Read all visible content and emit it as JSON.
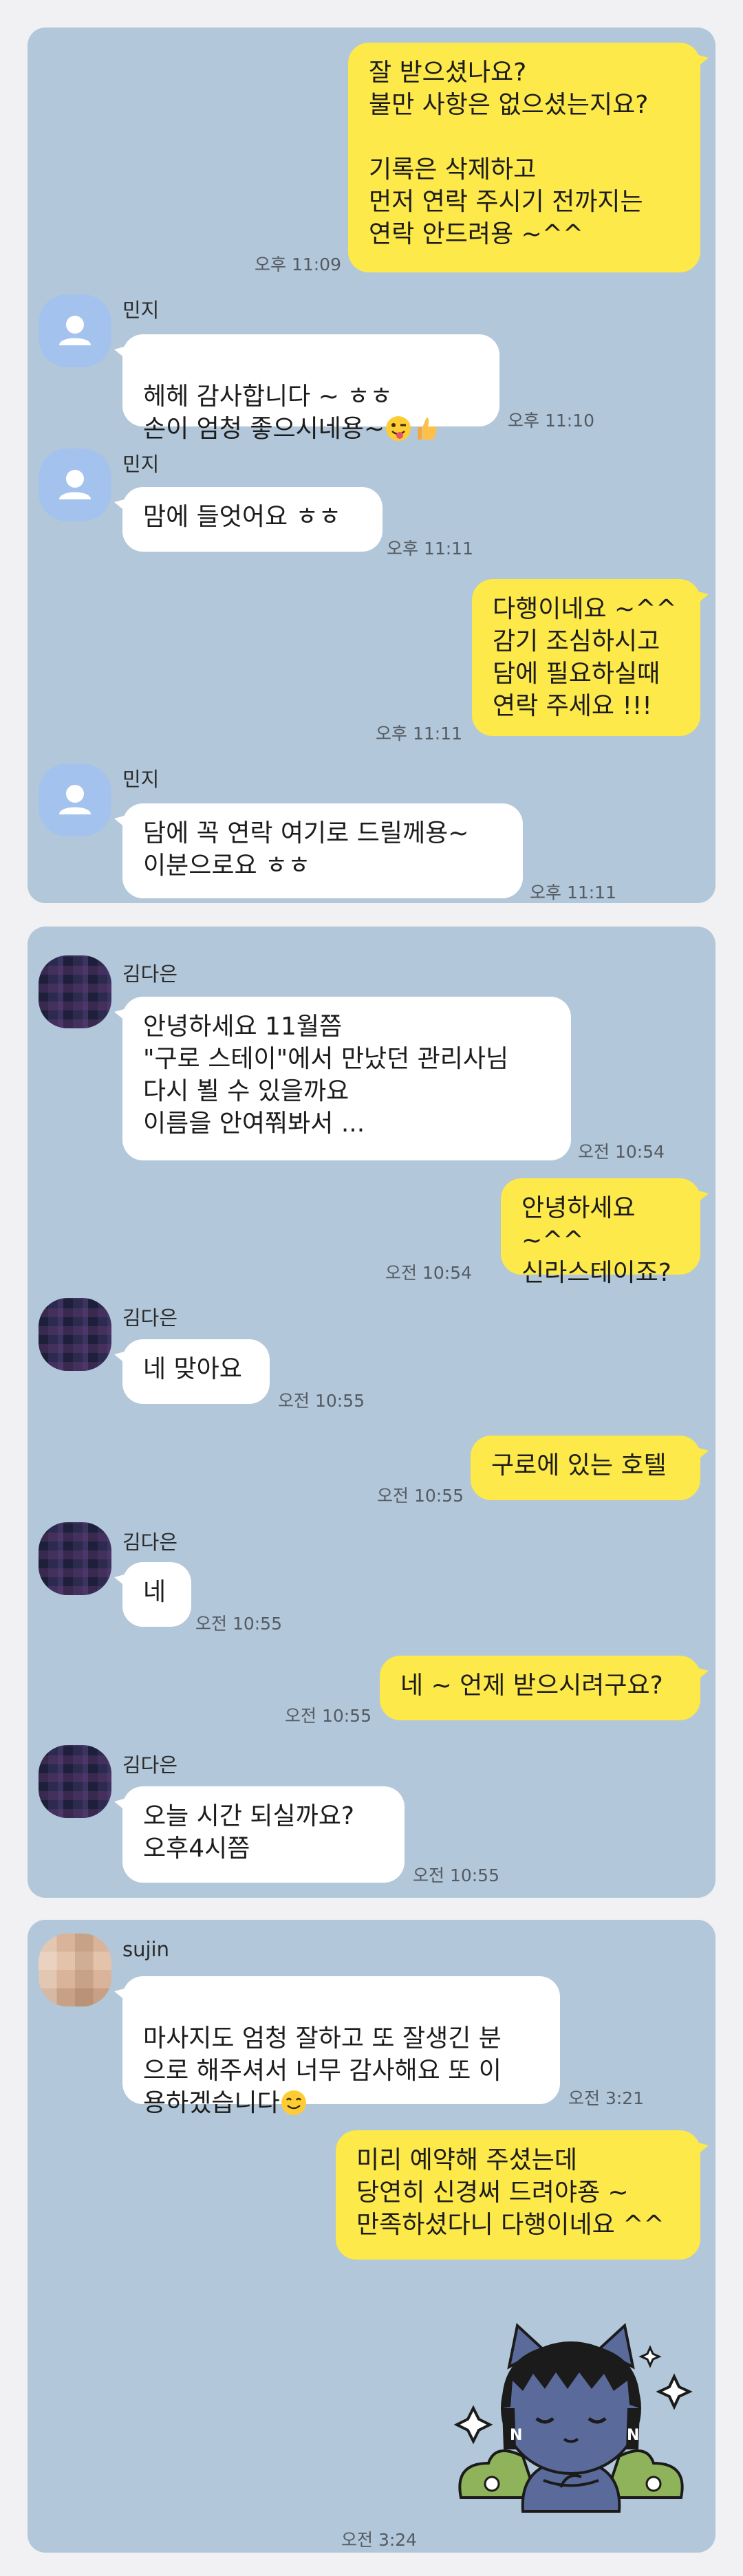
{
  "panels": [
    {
      "messages": [
        {
          "text": "잘 받으셨나요?\n불만 사항은 없으셨는지요?\n\n기록은 삭제하고\n먼저 연락 주시기 전까지는\n연락 안드려용 ~^^",
          "time": "오후 11:09"
        },
        {
          "sender": "민지",
          "text": "헤헤 감사합니다 ~ ㅎㅎ\n손이 엄청 좋으시네용~",
          "emojis": [
            "winking-tongue-emoji",
            "thumbs-up-emoji"
          ],
          "time": "오후 11:10"
        },
        {
          "sender": "민지",
          "text": "맘에 들엇어요 ㅎㅎ",
          "time": "오후 11:11"
        },
        {
          "text": "다행이네요 ~^^\n감기 조심하시고\n담에 필요하실때\n연락 주세요 !!!",
          "time": "오후 11:11"
        },
        {
          "sender": "민지",
          "text": "담에 꼭 연락 여기로 드릴께용~\n이분으로요 ㅎㅎ",
          "time": "오후 11:11"
        }
      ]
    },
    {
      "messages": [
        {
          "sender": "김다은",
          "text": "안녕하세요 11월쯤\n\"구로 스테이\"에서 만났던 관리사님\n다시 뵐 수 있을까요\n이름을 안여쭤봐서 ...",
          "time": "오전 10:54"
        },
        {
          "text": "안녕하세요 ~^^\n신라스테이죠?",
          "time": "오전 10:54"
        },
        {
          "sender": "김다은",
          "text": "네 맞아요",
          "time": "오전 10:55"
        },
        {
          "text": "구로에 있는 호텔",
          "time": "오전 10:55"
        },
        {
          "sender": "김다은",
          "text": "네",
          "time": "오전 10:55"
        },
        {
          "text": "네 ~ 언제 받으시려구요?",
          "time": "오전 10:55"
        },
        {
          "sender": "김다은",
          "text": "오늘  시간 되실까요?\n오후4시쯤",
          "time": "오전 10:55"
        }
      ]
    },
    {
      "messages": [
        {
          "sender": "sujin",
          "text": "마사지도 엄청 잘하고 또 잘생긴 분\n으로 해주셔서 너무 감사해요 또 이\n용하겠습니다",
          "emojis": [
            "smile-emoji"
          ],
          "time": "오전 3:21"
        },
        {
          "text": "미리 예약해 주셨는데\n당연히 신경써 드려야죵 ~\n만족하셨다니 다행이네요 ^^",
          "time": ""
        },
        {
          "sticker": "cat-character-sticker",
          "time": "오전 3:24"
        }
      ]
    }
  ],
  "colors": {
    "panel": "#b2c7d9",
    "my_bubble": "#fde94a",
    "other_bubble": "#ffffff",
    "page": "#f1f1f3"
  }
}
